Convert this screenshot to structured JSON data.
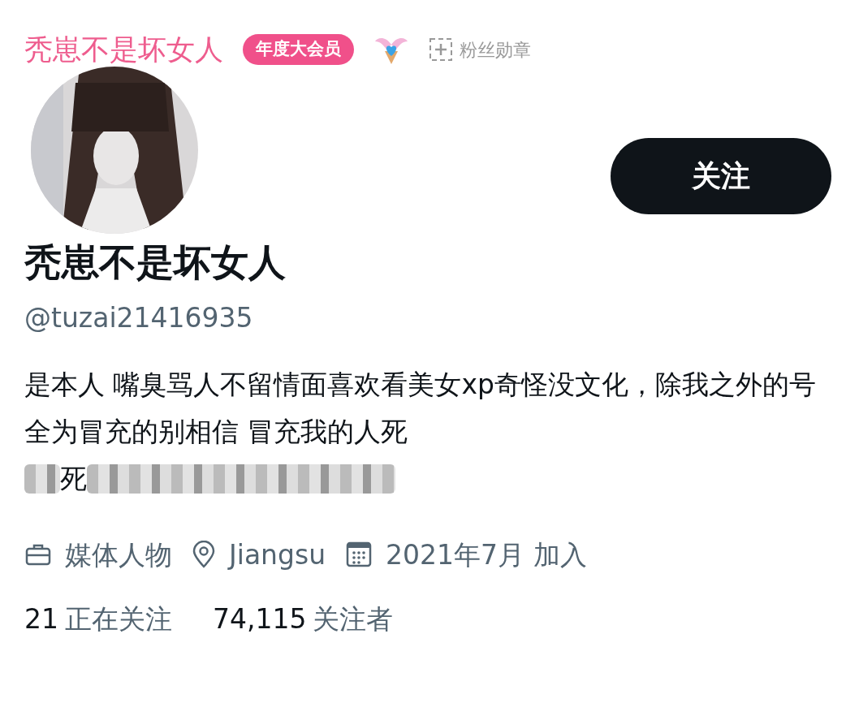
{
  "weibo_header": {
    "name": "秃崽不是坏女人",
    "member_badge": "年度大会员",
    "medal_label": "粉丝勋章"
  },
  "profile": {
    "follow_button": "关注",
    "display_name": "秃崽不是坏女人",
    "handle": "@tuzai21416935",
    "bio": "是本人 嘴臭骂人不留情面喜欢看美女xp奇怪没文化，除我之外的号全为冒充的别相信 冒充我的人死",
    "bio_visible_fragment": "死",
    "meta": [
      {
        "kind": "category",
        "text": "媒体人物"
      },
      {
        "kind": "location",
        "text": "Jiangsu"
      },
      {
        "kind": "joined",
        "text": "2021年7月 加入"
      }
    ],
    "stats": [
      {
        "count": "21",
        "label": "正在关注"
      },
      {
        "count": "74,115",
        "label": "关注者"
      }
    ]
  }
}
